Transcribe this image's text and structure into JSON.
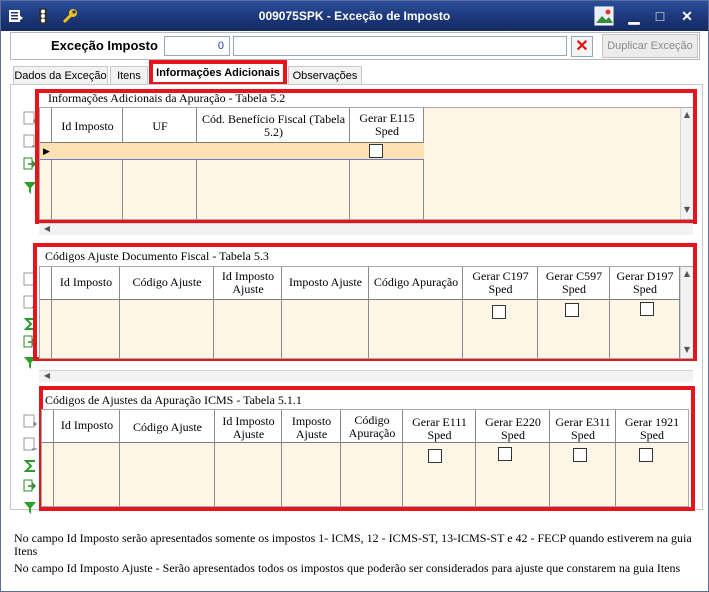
{
  "window": {
    "title": "009075SPK - Exceção de Imposto"
  },
  "header": {
    "label": "Exceção Imposto",
    "id_value": "0",
    "description_value": "",
    "clear_icon": "close-icon",
    "duplicate_label": "Duplicar Exceção"
  },
  "tabs": [
    {
      "label": "Dados da Exceção"
    },
    {
      "label": "Itens"
    },
    {
      "label": "Informações Adicionais"
    },
    {
      "label": "Observações"
    }
  ],
  "active_tab": "Informações Adicionais",
  "section1": {
    "title": "Informações Adicionais da Apuração - Tabela 5.2",
    "columns": [
      "Id Imposto",
      "UF",
      "Cód. Benefício Fiscal (Tabela 5.2)",
      "Gerar E115 Sped"
    ]
  },
  "section2": {
    "title": "Códigos Ajuste Documento Fiscal - Tabela 5.3",
    "columns": [
      "Id Imposto",
      "Código Ajuste",
      "Id Imposto Ajuste",
      "Imposto Ajuste",
      "Código Apuração",
      "Gerar C197 Sped",
      "Gerar C597 Sped",
      "Gerar D197 Sped"
    ]
  },
  "section3": {
    "title": "Códigos de Ajustes da Apuração ICMS - Tabela 5.1.1",
    "columns": [
      "Id Imposto",
      "Código Ajuste",
      "Id Imposto Ajuste",
      "Imposto Ajuste",
      "Código Apuração",
      "Gerar E111 Sped",
      "Gerar E220 Sped",
      "Gerar E311 Sped",
      "Gerar 1921 Sped"
    ]
  },
  "notes": {
    "line1": "No campo Id Imposto serão apresentados somente os impostos 1- ICMS, 12 - ICMS-ST, 13-ICMS-ST e 42 - FECP quando estiverem na guia Itens",
    "line2": "No campo Id Imposto Ajuste - Serão apresentados todos os impostos que poderão ser considerados para ajuste que constarem na guia Itens"
  },
  "colors": {
    "accent_red": "#e6141c",
    "title_bar": "#1c3576",
    "grid_bg": "#fdf6e6",
    "selected_row": "#fde0b4"
  }
}
